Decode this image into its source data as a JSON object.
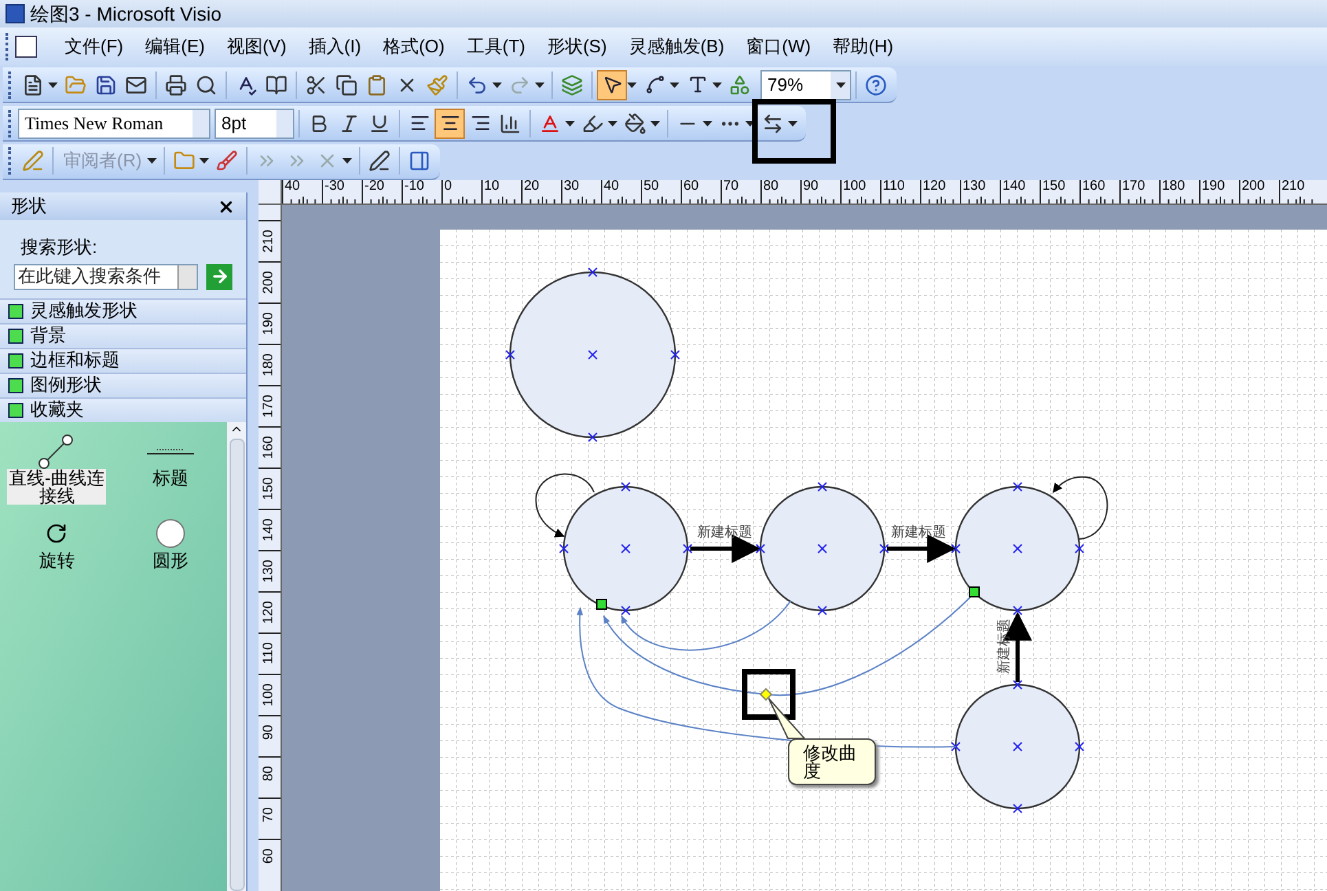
{
  "window": {
    "title": "绘图3 - Microsoft Visio"
  },
  "menu": [
    "文件(F)",
    "编辑(E)",
    "视图(V)",
    "插入(I)",
    "格式(O)",
    "工具(T)",
    "形状(S)",
    "灵感触发(B)",
    "窗口(W)",
    "帮助(H)"
  ],
  "standard_toolbar": {
    "tools": [
      {
        "kind": "pointer",
        "selected": true
      },
      {
        "kind": "connector",
        "selected": false
      },
      {
        "kind": "text",
        "selected": false
      }
    ],
    "zoom": "79%"
  },
  "format_toolbar": {
    "font": "Times New Roman",
    "size": "8pt",
    "alignment": [
      {
        "kind": "left",
        "selected": false
      },
      {
        "kind": "center",
        "selected": true
      },
      {
        "kind": "right",
        "selected": false
      }
    ]
  },
  "review_toolbar": {
    "reviewer": "审阅者(R)"
  },
  "shapes_panel": {
    "title": "形状",
    "search_label": "搜索形状:",
    "search_placeholder": "在此键入搜索条件",
    "stencils": [
      "灵感触发形状",
      "背景",
      "边框和标题",
      "图例形状",
      "收藏夹"
    ],
    "masters": [
      {
        "kind": "connector",
        "label": "直线-曲线连接线",
        "selected": true
      },
      {
        "kind": "title",
        "label": "标题",
        "selected": false
      },
      {
        "kind": "rotate",
        "label": "旋转",
        "selected": false
      },
      {
        "kind": "circle",
        "label": "圆形",
        "selected": false
      }
    ]
  },
  "rulers": {
    "horizontal": [
      "40",
      "-30",
      "-20",
      "-10",
      "0",
      "10",
      "20",
      "30",
      "40",
      "50",
      "60",
      "70",
      "80",
      "90",
      "100",
      "110",
      "120",
      "130",
      "140",
      "150",
      "160",
      "170",
      "180",
      "190",
      "200",
      "210"
    ],
    "vertical": [
      "210",
      "200",
      "190",
      "180",
      "170",
      "160",
      "150",
      "140",
      "130",
      "120",
      "110",
      "100",
      "90",
      "80",
      "70",
      "60"
    ]
  },
  "diagram": {
    "connector_labels": [
      "新建标题",
      "新建标题",
      "新建标题"
    ],
    "tooltip": "修改曲度"
  }
}
